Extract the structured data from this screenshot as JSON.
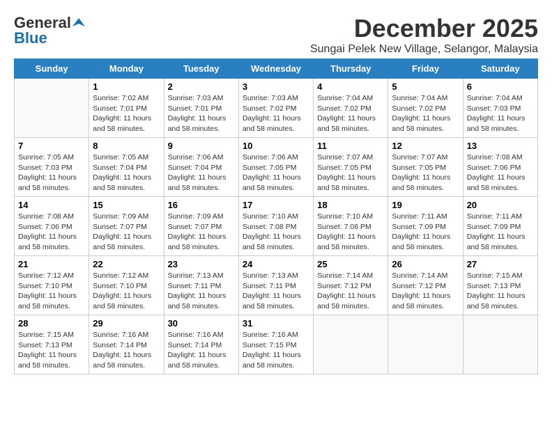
{
  "logo": {
    "line1": "General",
    "line2": "Blue"
  },
  "title": "December 2025",
  "location": "Sungai Pelek New Village, Selangor, Malaysia",
  "days_of_week": [
    "Sunday",
    "Monday",
    "Tuesday",
    "Wednesday",
    "Thursday",
    "Friday",
    "Saturday"
  ],
  "weeks": [
    [
      {
        "day": "",
        "info": ""
      },
      {
        "day": "1",
        "info": "Sunrise: 7:02 AM\nSunset: 7:01 PM\nDaylight: 11 hours\nand 58 minutes."
      },
      {
        "day": "2",
        "info": "Sunrise: 7:03 AM\nSunset: 7:01 PM\nDaylight: 11 hours\nand 58 minutes."
      },
      {
        "day": "3",
        "info": "Sunrise: 7:03 AM\nSunset: 7:02 PM\nDaylight: 11 hours\nand 58 minutes."
      },
      {
        "day": "4",
        "info": "Sunrise: 7:04 AM\nSunset: 7:02 PM\nDaylight: 11 hours\nand 58 minutes."
      },
      {
        "day": "5",
        "info": "Sunrise: 7:04 AM\nSunset: 7:02 PM\nDaylight: 11 hours\nand 58 minutes."
      },
      {
        "day": "6",
        "info": "Sunrise: 7:04 AM\nSunset: 7:03 PM\nDaylight: 11 hours\nand 58 minutes."
      }
    ],
    [
      {
        "day": "7",
        "info": "Sunrise: 7:05 AM\nSunset: 7:03 PM\nDaylight: 11 hours\nand 58 minutes."
      },
      {
        "day": "8",
        "info": "Sunrise: 7:05 AM\nSunset: 7:04 PM\nDaylight: 11 hours\nand 58 minutes."
      },
      {
        "day": "9",
        "info": "Sunrise: 7:06 AM\nSunset: 7:04 PM\nDaylight: 11 hours\nand 58 minutes."
      },
      {
        "day": "10",
        "info": "Sunrise: 7:06 AM\nSunset: 7:05 PM\nDaylight: 11 hours\nand 58 minutes."
      },
      {
        "day": "11",
        "info": "Sunrise: 7:07 AM\nSunset: 7:05 PM\nDaylight: 11 hours\nand 58 minutes."
      },
      {
        "day": "12",
        "info": "Sunrise: 7:07 AM\nSunset: 7:05 PM\nDaylight: 11 hours\nand 58 minutes."
      },
      {
        "day": "13",
        "info": "Sunrise: 7:08 AM\nSunset: 7:06 PM\nDaylight: 11 hours\nand 58 minutes."
      }
    ],
    [
      {
        "day": "14",
        "info": "Sunrise: 7:08 AM\nSunset: 7:06 PM\nDaylight: 11 hours\nand 58 minutes."
      },
      {
        "day": "15",
        "info": "Sunrise: 7:09 AM\nSunset: 7:07 PM\nDaylight: 11 hours\nand 58 minutes."
      },
      {
        "day": "16",
        "info": "Sunrise: 7:09 AM\nSunset: 7:07 PM\nDaylight: 11 hours\nand 58 minutes."
      },
      {
        "day": "17",
        "info": "Sunrise: 7:10 AM\nSunset: 7:08 PM\nDaylight: 11 hours\nand 58 minutes."
      },
      {
        "day": "18",
        "info": "Sunrise: 7:10 AM\nSunset: 7:08 PM\nDaylight: 11 hours\nand 58 minutes."
      },
      {
        "day": "19",
        "info": "Sunrise: 7:11 AM\nSunset: 7:09 PM\nDaylight: 11 hours\nand 58 minutes."
      },
      {
        "day": "20",
        "info": "Sunrise: 7:11 AM\nSunset: 7:09 PM\nDaylight: 11 hours\nand 58 minutes."
      }
    ],
    [
      {
        "day": "21",
        "info": "Sunrise: 7:12 AM\nSunset: 7:10 PM\nDaylight: 11 hours\nand 58 minutes."
      },
      {
        "day": "22",
        "info": "Sunrise: 7:12 AM\nSunset: 7:10 PM\nDaylight: 11 hours\nand 58 minutes."
      },
      {
        "day": "23",
        "info": "Sunrise: 7:13 AM\nSunset: 7:11 PM\nDaylight: 11 hours\nand 58 minutes."
      },
      {
        "day": "24",
        "info": "Sunrise: 7:13 AM\nSunset: 7:11 PM\nDaylight: 11 hours\nand 58 minutes."
      },
      {
        "day": "25",
        "info": "Sunrise: 7:14 AM\nSunset: 7:12 PM\nDaylight: 11 hours\nand 58 minutes."
      },
      {
        "day": "26",
        "info": "Sunrise: 7:14 AM\nSunset: 7:12 PM\nDaylight: 11 hours\nand 58 minutes."
      },
      {
        "day": "27",
        "info": "Sunrise: 7:15 AM\nSunset: 7:13 PM\nDaylight: 11 hours\nand 58 minutes."
      }
    ],
    [
      {
        "day": "28",
        "info": "Sunrise: 7:15 AM\nSunset: 7:13 PM\nDaylight: 11 hours\nand 58 minutes."
      },
      {
        "day": "29",
        "info": "Sunrise: 7:16 AM\nSunset: 7:14 PM\nDaylight: 11 hours\nand 58 minutes."
      },
      {
        "day": "30",
        "info": "Sunrise: 7:16 AM\nSunset: 7:14 PM\nDaylight: 11 hours\nand 58 minutes."
      },
      {
        "day": "31",
        "info": "Sunrise: 7:16 AM\nSunset: 7:15 PM\nDaylight: 11 hours\nand 58 minutes."
      },
      {
        "day": "",
        "info": ""
      },
      {
        "day": "",
        "info": ""
      },
      {
        "day": "",
        "info": ""
      }
    ]
  ]
}
